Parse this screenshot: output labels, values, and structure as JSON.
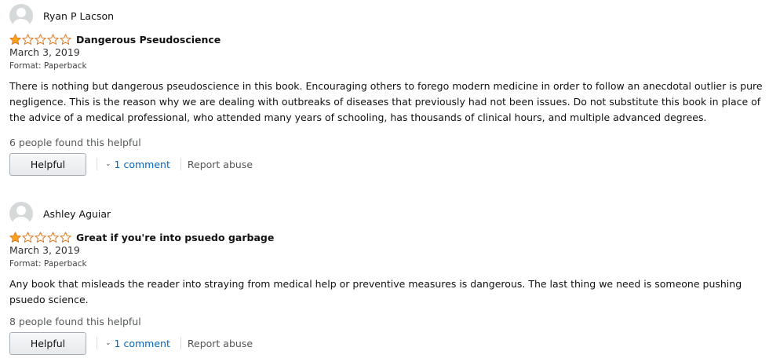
{
  "colors": {
    "star_fill": "#ffa41c",
    "star_outline": "#de7921",
    "link": "#0066c0"
  },
  "reviews": [
    {
      "profile_name": "Ryan P Lacson",
      "rating": 1,
      "rating_max": 5,
      "title": "Dangerous Pseudoscience",
      "date": "March 3, 2019",
      "format": "Format: Paperback",
      "body": "There is nothing but dangerous pseudoscience in this book. Encouraging others to forego modern medicine in order to follow an anecdotal outlier is pure negligence. This is the reason why we are dealing with outbreaks of diseases that previously had not been issues. Do not substitute this book in place of the advice of a medical professional, who attended many years of schooling, has thousands of clinical hours, and multiple advanced degrees.",
      "helpful_count": "6 people found this helpful",
      "helpful_label": "Helpful",
      "comments_label": "1 comment",
      "report_label": "Report abuse"
    },
    {
      "profile_name": "Ashley Aguiar",
      "rating": 1,
      "rating_max": 5,
      "title": "Great if you're into psuedo garbage",
      "date": "March 3, 2019",
      "format": "Format: Paperback",
      "body": "Any book that misleads the reader into straying from medical help or preventive measures is dangerous. The last thing we need is someone pushing psuedo science.",
      "helpful_count": "8 people found this helpful",
      "helpful_label": "Helpful",
      "comments_label": "1 comment",
      "report_label": "Report abuse"
    }
  ]
}
